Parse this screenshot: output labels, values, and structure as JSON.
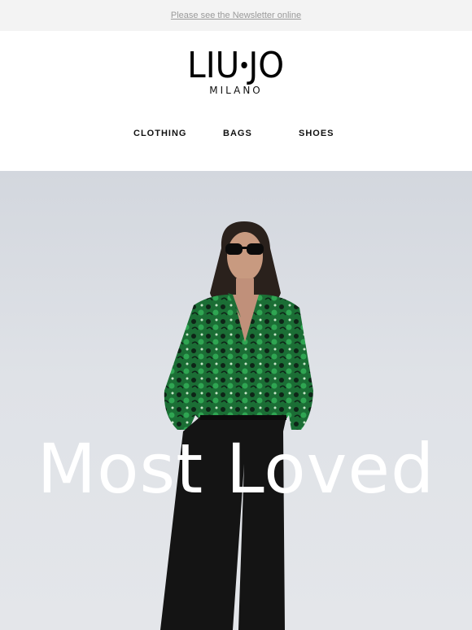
{
  "preheader": {
    "link_text": "Please see the Newsletter online"
  },
  "brand": {
    "name_left": "LIU",
    "name_right": "JO",
    "subline": "MILANO"
  },
  "nav": {
    "items": [
      {
        "label": "CLOTHING"
      },
      {
        "label": "BAGS"
      },
      {
        "label": "SHOES"
      }
    ]
  },
  "hero": {
    "title": "Most Loved"
  },
  "colors": {
    "background": "#ffffff",
    "preheader_bg": "#f3f3f3",
    "hero_bg": "#dcdfe4",
    "blouse_green": "#1f7a3a",
    "pants": "#141414"
  }
}
